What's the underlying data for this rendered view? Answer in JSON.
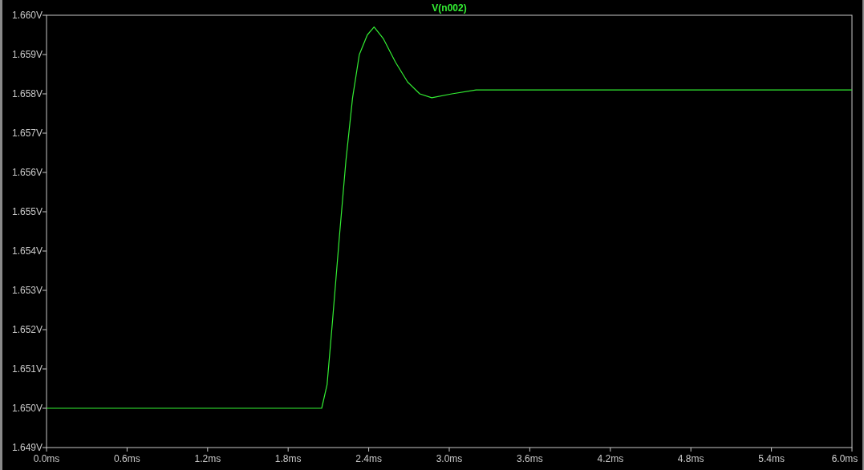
{
  "chart_data": {
    "type": "line",
    "x": [
      0,
      0.5,
      1.0,
      1.5,
      2.0,
      2.05,
      2.09,
      2.13,
      2.18,
      2.23,
      2.28,
      2.33,
      2.39,
      2.44,
      2.51,
      2.6,
      2.69,
      2.78,
      2.87,
      3.02,
      3.2,
      3.5,
      4.0,
      5.0,
      6.0
    ],
    "series": [
      {
        "name": "V(n002)",
        "color": "#33ee33",
        "values": [
          1.65,
          1.65,
          1.65,
          1.65,
          1.65,
          1.65,
          1.6506,
          1.6522,
          1.6543,
          1.6563,
          1.6579,
          1.659,
          1.6595,
          1.6597,
          1.6594,
          1.6588,
          1.6583,
          1.658,
          1.6579,
          1.658,
          1.6581,
          1.6581,
          1.6581,
          1.6581,
          1.6581
        ]
      }
    ],
    "xlim": [
      0,
      6
    ],
    "ylim": [
      1.649,
      1.66
    ],
    "xticks": [
      {
        "value": 0,
        "label": "0.0ms"
      },
      {
        "value": 0.6,
        "label": "0.6ms"
      },
      {
        "value": 1.2,
        "label": "1.2ms"
      },
      {
        "value": 1.8,
        "label": "1.8ms"
      },
      {
        "value": 2.4,
        "label": "2.4ms"
      },
      {
        "value": 3.0,
        "label": "3.0ms"
      },
      {
        "value": 3.6,
        "label": "3.6ms"
      },
      {
        "value": 4.2,
        "label": "4.2ms"
      },
      {
        "value": 4.8,
        "label": "4.8ms"
      },
      {
        "value": 5.4,
        "label": "5.4ms"
      },
      {
        "value": 6.0,
        "label": "6.0ms"
      }
    ],
    "yticks": [
      {
        "value": 1.66,
        "label": "1.660V"
      },
      {
        "value": 1.659,
        "label": "1.659V"
      },
      {
        "value": 1.658,
        "label": "1.658V"
      },
      {
        "value": 1.657,
        "label": "1.657V"
      },
      {
        "value": 1.656,
        "label": "1.656V"
      },
      {
        "value": 1.655,
        "label": "1.655V"
      },
      {
        "value": 1.654,
        "label": "1.654V"
      },
      {
        "value": 1.653,
        "label": "1.653V"
      },
      {
        "value": 1.652,
        "label": "1.652V"
      },
      {
        "value": 1.651,
        "label": "1.651V"
      },
      {
        "value": 1.65,
        "label": "1.650V"
      },
      {
        "value": 1.649,
        "label": "1.649V"
      }
    ]
  }
}
